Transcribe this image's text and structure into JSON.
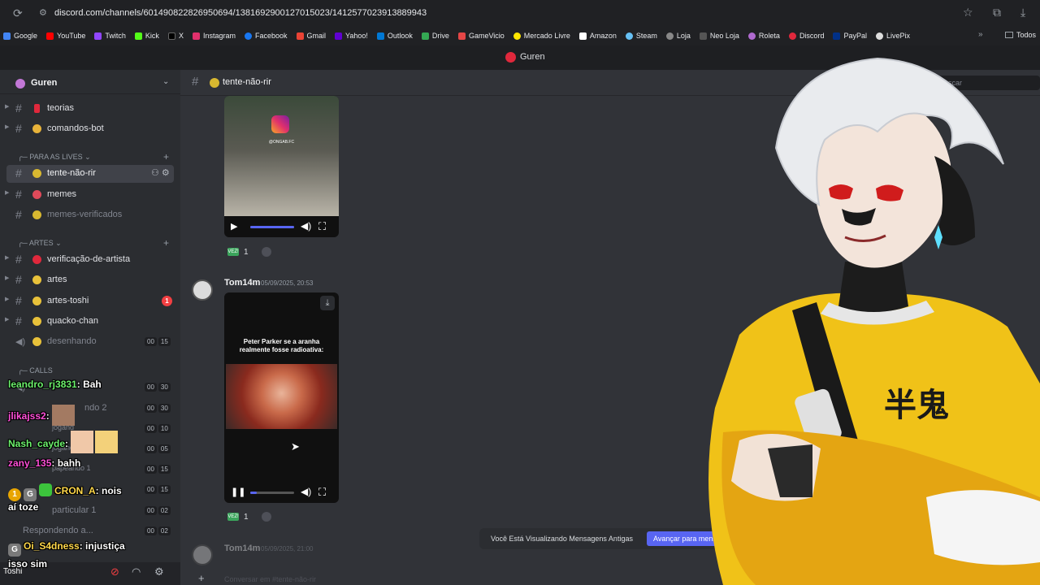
{
  "browser": {
    "url": "discord.com/channels/601490822826950694/1381692900127015023/1412577023913889943",
    "bookmarks": [
      "Google",
      "YouTube",
      "Twitch",
      "Kick",
      "X",
      "Instagram",
      "Facebook",
      "Gmail",
      "Yahoo!",
      "Outlook",
      "Drive",
      "GameVicio",
      "Mercado Livre",
      "Amazon",
      "Steam",
      "Loja",
      "Neo Loja",
      "Roleta",
      "Discord",
      "PayPal",
      "LivePix"
    ],
    "all_bookmarks": "Todos"
  },
  "app": {
    "title": "Guren"
  },
  "sidebar": {
    "server_name": "Guren",
    "channels_top": [
      {
        "label": "teorias",
        "color": "#e0283c"
      },
      {
        "label": "comandos-bot",
        "color": "#e8b33a"
      }
    ],
    "category_lives": "PARA AS LIVES",
    "channels_lives": [
      {
        "label": "tente-não-rir",
        "color": "#d8b830"
      },
      {
        "label": "memes",
        "color": "#e04a5a"
      },
      {
        "label": "memes-verificados",
        "color": "#d8b830"
      }
    ],
    "category_artes": "ARTES",
    "channels_artes": [
      {
        "label": "verificação-de-artista",
        "color": "#e0283c"
      },
      {
        "label": "artes",
        "color": "#e8c13a"
      },
      {
        "label": "artes-toshi",
        "color": "#e8c13a",
        "badge": "1"
      },
      {
        "label": "quacko-chan",
        "color": "#e8c13a"
      }
    ],
    "voice_desenhando": {
      "label": "desenhando",
      "c1": "00",
      "c2": "15"
    },
    "category_calls": "CALLS",
    "voice_counts": [
      {
        "c1": "00",
        "c2": "30"
      },
      {
        "c1": "00",
        "c2": "30"
      },
      {
        "c1": "00",
        "c2": "10"
      },
      {
        "c1": "00",
        "c2": "05"
      },
      {
        "c1": "00",
        "c2": "15"
      },
      {
        "c1": "00",
        "c2": "15"
      },
      {
        "c1": "00",
        "c2": "02"
      },
      {
        "c1": "00",
        "c2": "02"
      }
    ],
    "voice_labels": [
      "ndo 2",
      "jogand",
      "jogand",
      "papeando 1",
      "particular 1",
      "Respondendo a..."
    ],
    "bottom_user": "Toshi"
  },
  "chat_overlay": [
    {
      "user": "leandro_rj3831",
      "msg": "Bah"
    },
    {
      "user": "jlikajss2",
      "msg": ""
    },
    {
      "user": "Nash_cayde",
      "msg": ""
    },
    {
      "user": "zany_135",
      "msg": "bahh"
    },
    {
      "user": "CRON_A",
      "msg": "nois"
    },
    {
      "user": "",
      "msg": "aí toze"
    },
    {
      "user": "Oi_S4dness",
      "msg": "injustiça"
    },
    {
      "user": "",
      "msg": "isso sim"
    }
  ],
  "channel": {
    "name": "tente-não-rir",
    "search_placeholder": "Buscar"
  },
  "messages": [
    {
      "reaction_count": "1",
      "watermark": "@ONGAB.FC"
    },
    {
      "author": "Tom14m",
      "timestamp": "05/09/2025, 20:53",
      "video_caption": "Peter Parker se a aranha realmente fosse radioativa:",
      "reaction_count": "1"
    },
    {
      "author": "Tom14m",
      "timestamp": "05/09/2025, 21:00"
    }
  ],
  "old_messages_banner": {
    "text": "Você Está Visualizando Mensagens Antigas",
    "button": "Avançar para mens"
  },
  "composer": {
    "placeholder": "Conversar em #tente-não-rir"
  },
  "overlay_character": {
    "shirt_text": "半鬼"
  }
}
